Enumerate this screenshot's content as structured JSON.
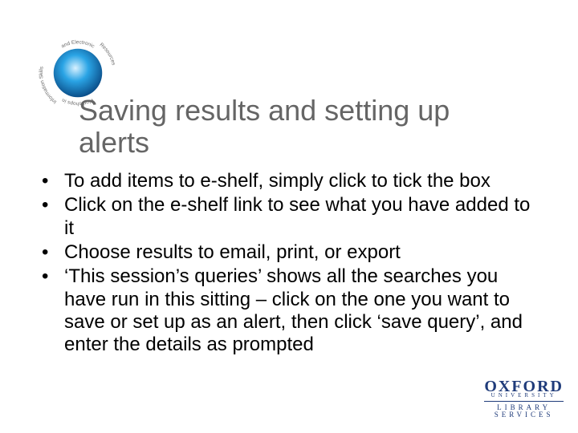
{
  "title": "Saving results and setting up alerts",
  "bullets": [
    "To add items to e-shelf, simply click to tick the box",
    "Click on the e-shelf link to see what you have added to it",
    "Choose results to email, print, or export",
    "‘This session’s queries’ shows all the searches you have run in this sitting – click on the one you want to save or set up as an alert, then click ‘save query’, and enter the details as prompted"
  ],
  "footer": {
    "line1": "OXFORD",
    "line2": "UNIVERSITY",
    "line3": "LIBRARY",
    "line4": "SERVICES"
  },
  "logo": {
    "outer_text_top": "and Electronic",
    "outer_text_left": "Information Skills",
    "outer_text_right": "Resources",
    "outer_text_bottom": "Workshops in"
  }
}
